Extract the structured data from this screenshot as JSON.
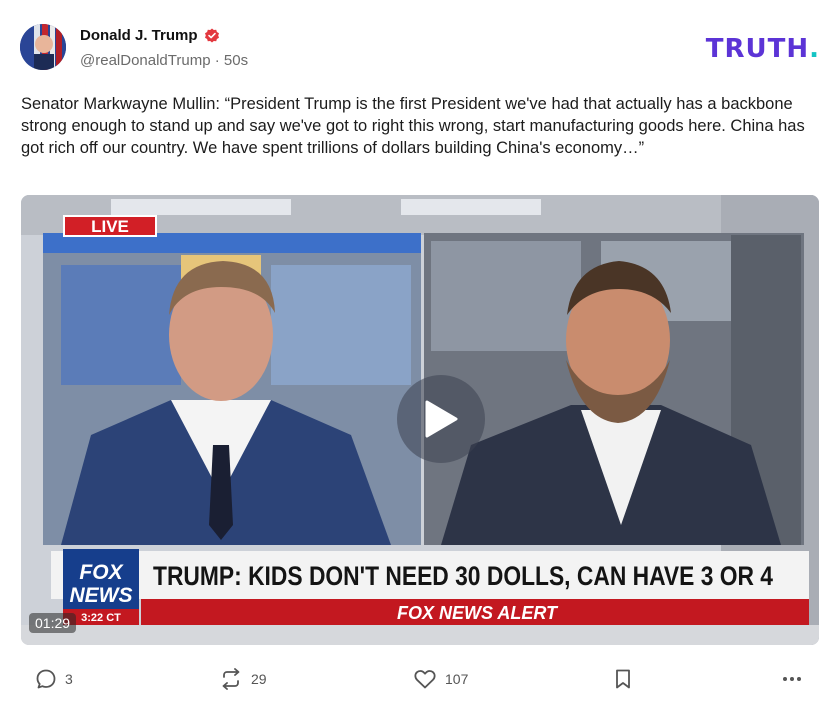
{
  "author": {
    "display_name": "Donald J. Trump",
    "handle": "@realDonaldTrump",
    "separator": "·",
    "time": "50s"
  },
  "brand": {
    "logo_text": "TRUTH",
    "logo_dot": ".",
    "accent": "#5c34d6",
    "dot_color": "#14c4c4"
  },
  "post": {
    "text": "Senator Markwayne Mullin: “President Trump is the first President we've had that actually has a backbone strong enough to stand up and say we've got to right this wrong, start manufacturing goods here. China has got rich off our country. We have spent trillions of dollars building China's economy…”"
  },
  "video": {
    "duration": "01:29",
    "live_label": "LIVE",
    "chyron": "TRUMP: KIDS DON'T NEED 30 DOLLS, CAN HAVE 3 OR 4",
    "network_top": "FOX",
    "network_bottom": "NEWS",
    "clock": "3:22 CT",
    "alert": "FOX NEWS ALERT",
    "play_icon": "play-icon"
  },
  "actions": {
    "replies": "3",
    "retruths": "29",
    "likes": "107"
  }
}
